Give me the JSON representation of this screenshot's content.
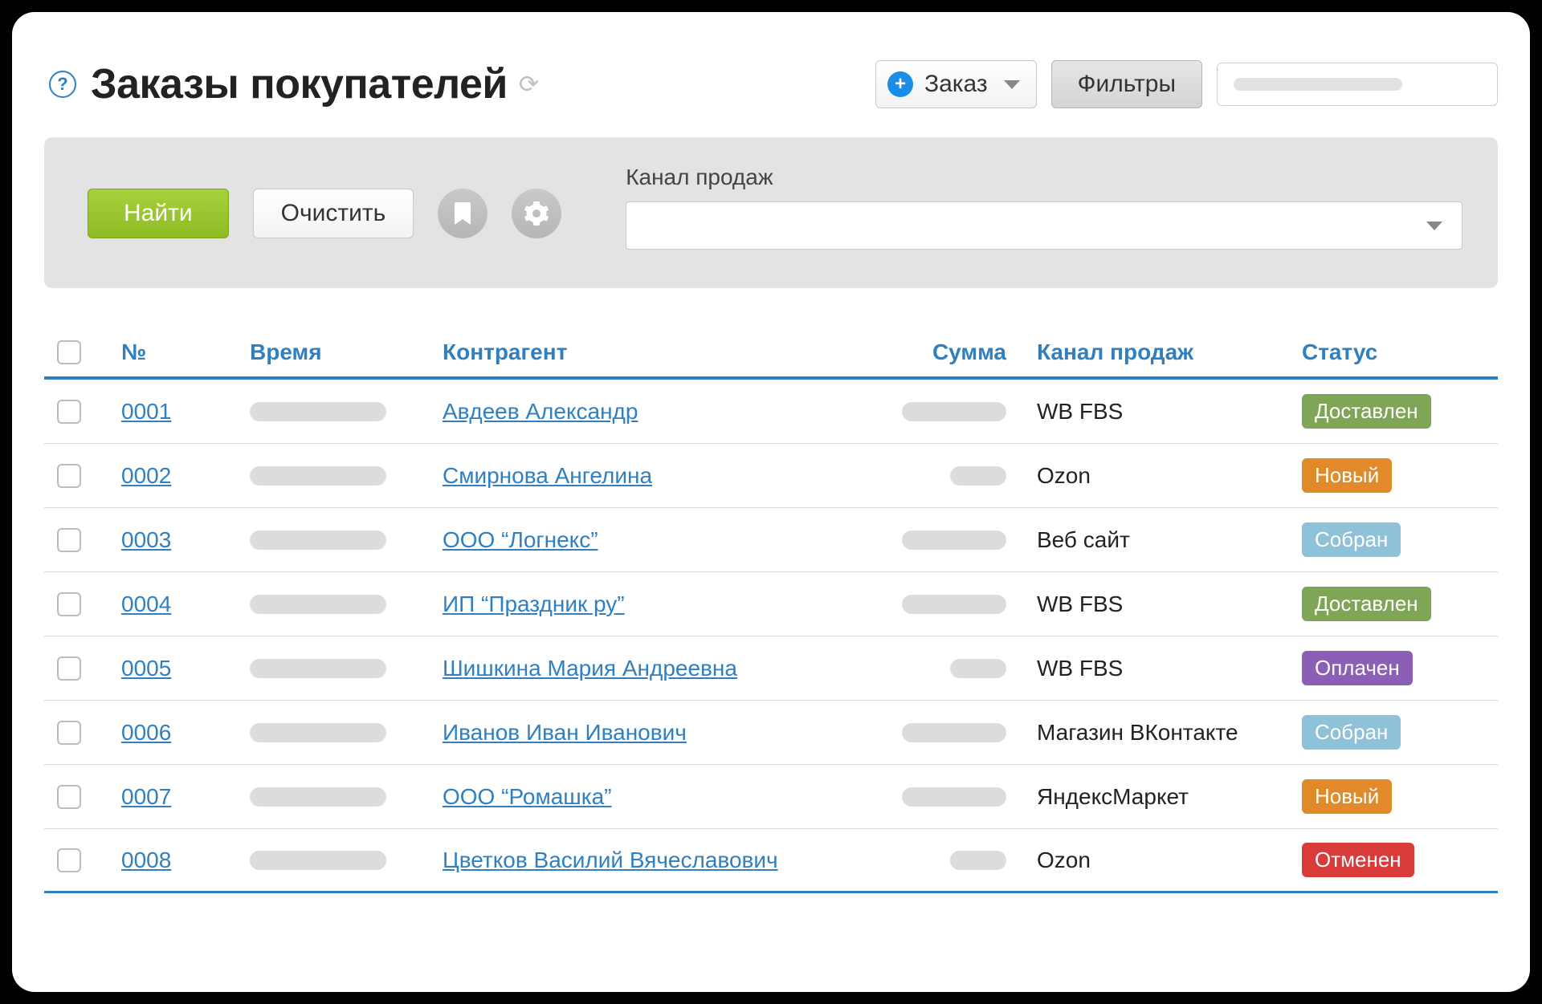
{
  "header": {
    "title": "Заказы покупателей",
    "help_glyph": "?",
    "order_button": "Заказ",
    "filters_button": "Фильтры"
  },
  "filter_panel": {
    "find": "Найти",
    "clear": "Очистить",
    "channel_label": "Канал продаж"
  },
  "columns": {
    "number": "№",
    "time": "Время",
    "counterparty": "Контрагент",
    "sum": "Сумма",
    "channel": "Канал продаж",
    "status": "Статус"
  },
  "status_labels": {
    "delivered": "Доставлен",
    "new": "Новый",
    "collected": "Собран",
    "paid": "Оплачен",
    "cancelled": "Отменен"
  },
  "rows": [
    {
      "num": "0001",
      "counterparty": "Авдеев Александр",
      "sum_w": "w1",
      "channel": "WB FBS",
      "status": "delivered"
    },
    {
      "num": "0002",
      "counterparty": "Смирнова Ангелина",
      "sum_w": "w2",
      "channel": "Ozon",
      "status": "new"
    },
    {
      "num": "0003",
      "counterparty": "ООО “Логнекс”",
      "sum_w": "w1",
      "channel": "Веб сайт",
      "status": "collected"
    },
    {
      "num": "0004",
      "counterparty": "ИП “Праздник ру”",
      "sum_w": "w1",
      "channel": "WB FBS",
      "status": "delivered"
    },
    {
      "num": "0005",
      "counterparty": "Шишкина Мария Андреевна",
      "sum_w": "w2",
      "channel": "WB FBS",
      "status": "paid"
    },
    {
      "num": "0006",
      "counterparty": "Иванов Иван Иванович",
      "sum_w": "w1",
      "channel": "Магазин ВКонтакте",
      "status": "collected"
    },
    {
      "num": "0007",
      "counterparty": "ООО “Ромашка”",
      "sum_w": "w1",
      "channel": "ЯндексМаркет",
      "status": "new"
    },
    {
      "num": "0008",
      "counterparty": "Цветков Василий Вячеславович",
      "sum_w": "w2",
      "channel": "Ozon",
      "status": "cancelled"
    }
  ]
}
